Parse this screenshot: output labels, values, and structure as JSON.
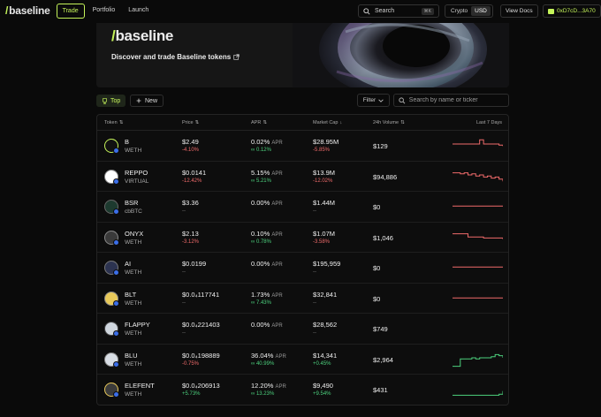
{
  "nav": {
    "logo": "baseline",
    "tabs": [
      {
        "label": "Trade",
        "active": true
      },
      {
        "label": "Portfolio",
        "active": false
      },
      {
        "label": "Launch",
        "active": false
      }
    ],
    "search_label": "Search",
    "search_shortcut": "⌘K",
    "currency_options": [
      "Crypto",
      "USD"
    ],
    "currency_selected": "USD",
    "docs_label": "View Docs",
    "wallet": "0xD7cD...3A70"
  },
  "hero": {
    "title": "baseline",
    "subtitle": "Discover and trade Baseline tokens"
  },
  "filters": {
    "top_label": "Top",
    "new_label": "New",
    "filter_label": "Filter",
    "search_placeholder": "Search by name or ticker"
  },
  "table": {
    "headers": {
      "token": "Token",
      "price": "Price",
      "apr": "APR",
      "mcap": "Market Cap",
      "volume": "24h Volume",
      "chart": "Last 7 Days"
    },
    "rows": [
      {
        "name": "B",
        "pair": "WETH",
        "price": "$2.49",
        "price_change": "-4.10%",
        "apr": "0.02%",
        "apr_label": "APR",
        "apr_sub": "∞ 0.12%",
        "mcap": "$28.95M",
        "mcap_change": "-5.85%",
        "volume": "$129",
        "logo_color": "#111111",
        "ring": "#c5f45a",
        "trend": "down",
        "spark": [
          5,
          5,
          5,
          5,
          5,
          5,
          5,
          1,
          5,
          5,
          5,
          5,
          6,
          7
        ]
      },
      {
        "name": "REPPO",
        "pair": "VIRTUAL",
        "price": "$0.0141",
        "price_change": "-12.42%",
        "apr": "5.15%",
        "apr_label": "APR",
        "apr_sub": "∞ 5.21%",
        "mcap": "$13.9M",
        "mcap_change": "-12.02%",
        "volume": "$94,886",
        "logo_color": "#ffffff",
        "ring": "#888888",
        "trend": "down",
        "spark": [
          3,
          3,
          4,
          3,
          5,
          4,
          6,
          5,
          7,
          6,
          8,
          7,
          9,
          11
        ]
      },
      {
        "name": "BSR",
        "pair": "cbBTC",
        "price": "$3.36",
        "price_change": "--",
        "apr": "0.00%",
        "apr_label": "APR",
        "apr_sub": "",
        "mcap": "$1.44M",
        "mcap_change": "--",
        "volume": "$0",
        "logo_color": "#1d3a2f",
        "ring": "#666666",
        "trend": "down",
        "spark": [
          6,
          6,
          6,
          6,
          6,
          6,
          6,
          6,
          6,
          6,
          6,
          6,
          6,
          6
        ]
      },
      {
        "name": "ONYX",
        "pair": "WETH",
        "price": "$2.13",
        "price_change": "-3.12%",
        "apr": "0.10%",
        "apr_label": "APR",
        "apr_sub": "∞ 0.78%",
        "mcap": "$1.07M",
        "mcap_change": "-3.58%",
        "volume": "$1,046",
        "logo_color": "#3a3a3a",
        "ring": "#888888",
        "trend": "down",
        "spark": [
          3,
          3,
          3,
          3,
          6,
          6,
          6,
          6,
          7,
          7,
          7,
          7,
          7,
          8
        ]
      },
      {
        "name": "AI",
        "pair": "WETH",
        "price": "$0.0199",
        "price_change": "--",
        "apr": "0.00%",
        "apr_label": "APR",
        "apr_sub": "",
        "mcap": "$195,959",
        "mcap_change": "--",
        "volume": "$0",
        "logo_color": "#2c3350",
        "ring": "#777777",
        "trend": "down",
        "spark": [
          6,
          6,
          6,
          6,
          6,
          6,
          6,
          6,
          6,
          6,
          6,
          6,
          6,
          6
        ]
      },
      {
        "name": "BLT",
        "pair": "WETH",
        "price": "$0.0₄117741",
        "price_change": "--",
        "apr": "1.73%",
        "apr_label": "APR",
        "apr_sub": "∞ 7.43%",
        "mcap": "$32,841",
        "mcap_change": "--",
        "volume": "$0",
        "logo_color": "#e8c95a",
        "ring": "#888888",
        "trend": "down",
        "spark": [
          6,
          6,
          6,
          6,
          6,
          6,
          6,
          6,
          6,
          6,
          6,
          6,
          6,
          6
        ]
      },
      {
        "name": "FLAPPY",
        "pair": "WETH",
        "price": "$0.0₄221403",
        "price_change": "--",
        "apr": "0.00%",
        "apr_label": "APR",
        "apr_sub": "",
        "mcap": "$28,562",
        "mcap_change": "--",
        "volume": "$749",
        "logo_color": "#cfd6de",
        "ring": "#444444",
        "trend": "none",
        "spark": []
      },
      {
        "name": "BLU",
        "pair": "WETH",
        "price": "$0.0₄198889",
        "price_change": "-0.75%",
        "apr": "36.04%",
        "apr_label": "APR",
        "apr_sub": "∞ 40.99%",
        "mcap": "$14,341",
        "mcap_change": "+0.45%",
        "volume": "$2,964",
        "logo_color": "#d8dde4",
        "ring": "#888888",
        "trend": "up",
        "spark": [
          13,
          13,
          6,
          6,
          6,
          5,
          6,
          5,
          5,
          5,
          4,
          2,
          3,
          5
        ]
      },
      {
        "name": "ELEFENT",
        "pair": "WETH",
        "price": "$0.0₄206913",
        "price_change": "+5.73%",
        "apr": "12.20%",
        "apr_label": "APR",
        "apr_sub": "∞ 13.23%",
        "mcap": "$9,490",
        "mcap_change": "+9.54%",
        "volume": "$431",
        "logo_color": "#3b3b3b",
        "ring": "#e8c95a",
        "trend": "up",
        "spark": [
          12,
          12,
          12,
          12,
          12,
          12,
          12,
          12,
          12,
          12,
          12,
          12,
          11,
          8
        ]
      }
    ]
  },
  "colors": {
    "accent": "#c5f45a",
    "negative": "#f06b6b",
    "positive": "#4cd07d",
    "background": "#0a0a0a"
  },
  "icons": [
    "search-icon",
    "external-link-icon",
    "trophy-icon",
    "plus-icon",
    "chevron-down-icon",
    "sort-icon",
    "wallet-icon"
  ]
}
